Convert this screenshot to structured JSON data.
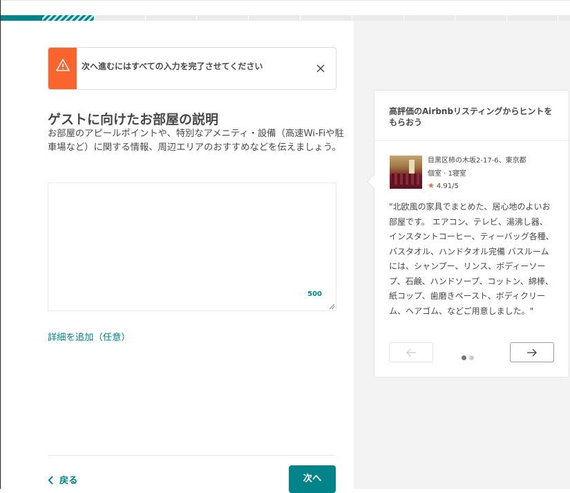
{
  "progress": {
    "completed_fraction": 0.07,
    "steps_visible": 11
  },
  "alert": {
    "message": "次へ進むにはすべての入力を完了させてください",
    "icon": "warning-icon",
    "close_icon": "close-icon",
    "accent_color": "#fc642d"
  },
  "main": {
    "title": "ゲストに向けたお部屋の説明",
    "description": "お部屋のアピールポイントや、特別なアメニティ・設備（高速Wi-Fiや駐車場など）に関する情報、周辺エリアのおすすめなどを伝えましょう。",
    "textarea": {
      "value": "",
      "placeholder": "",
      "char_remaining": "500"
    },
    "add_detail_link": "詳細を追加（任意）"
  },
  "footer": {
    "back_label": "戻る",
    "next_label": "次へ"
  },
  "tip": {
    "heading": "高評価のAirbnbリスティングからヒントをもらおう",
    "listing": {
      "address": "目黒区柿の木坂2-17-6、東京都",
      "room_type": "個室 · 1寝室",
      "rating": "4.91/5"
    },
    "quote": "\"北欧風の家具でまとめた、居心地のよいお部屋です。 エアコン、テレビ、湯沸し器、インスタントコーヒー、ティーバッグ各種、バスタオル、ハンドタオル完備 バスルームには、シャンプー、リンス、ボディーソープ、石鹸、ハンドソープ、コットン、綿棒、紙コップ、歯磨きペースト、ボディクリーム、ヘアゴム、などご用意しました。\"",
    "pager": {
      "current": 1,
      "total": 2
    }
  },
  "colors": {
    "accent": "#008489",
    "warning": "#fc642d",
    "rating_star": "#fc642d",
    "text": "#484848",
    "panel_bg": "#f3f3f3"
  }
}
